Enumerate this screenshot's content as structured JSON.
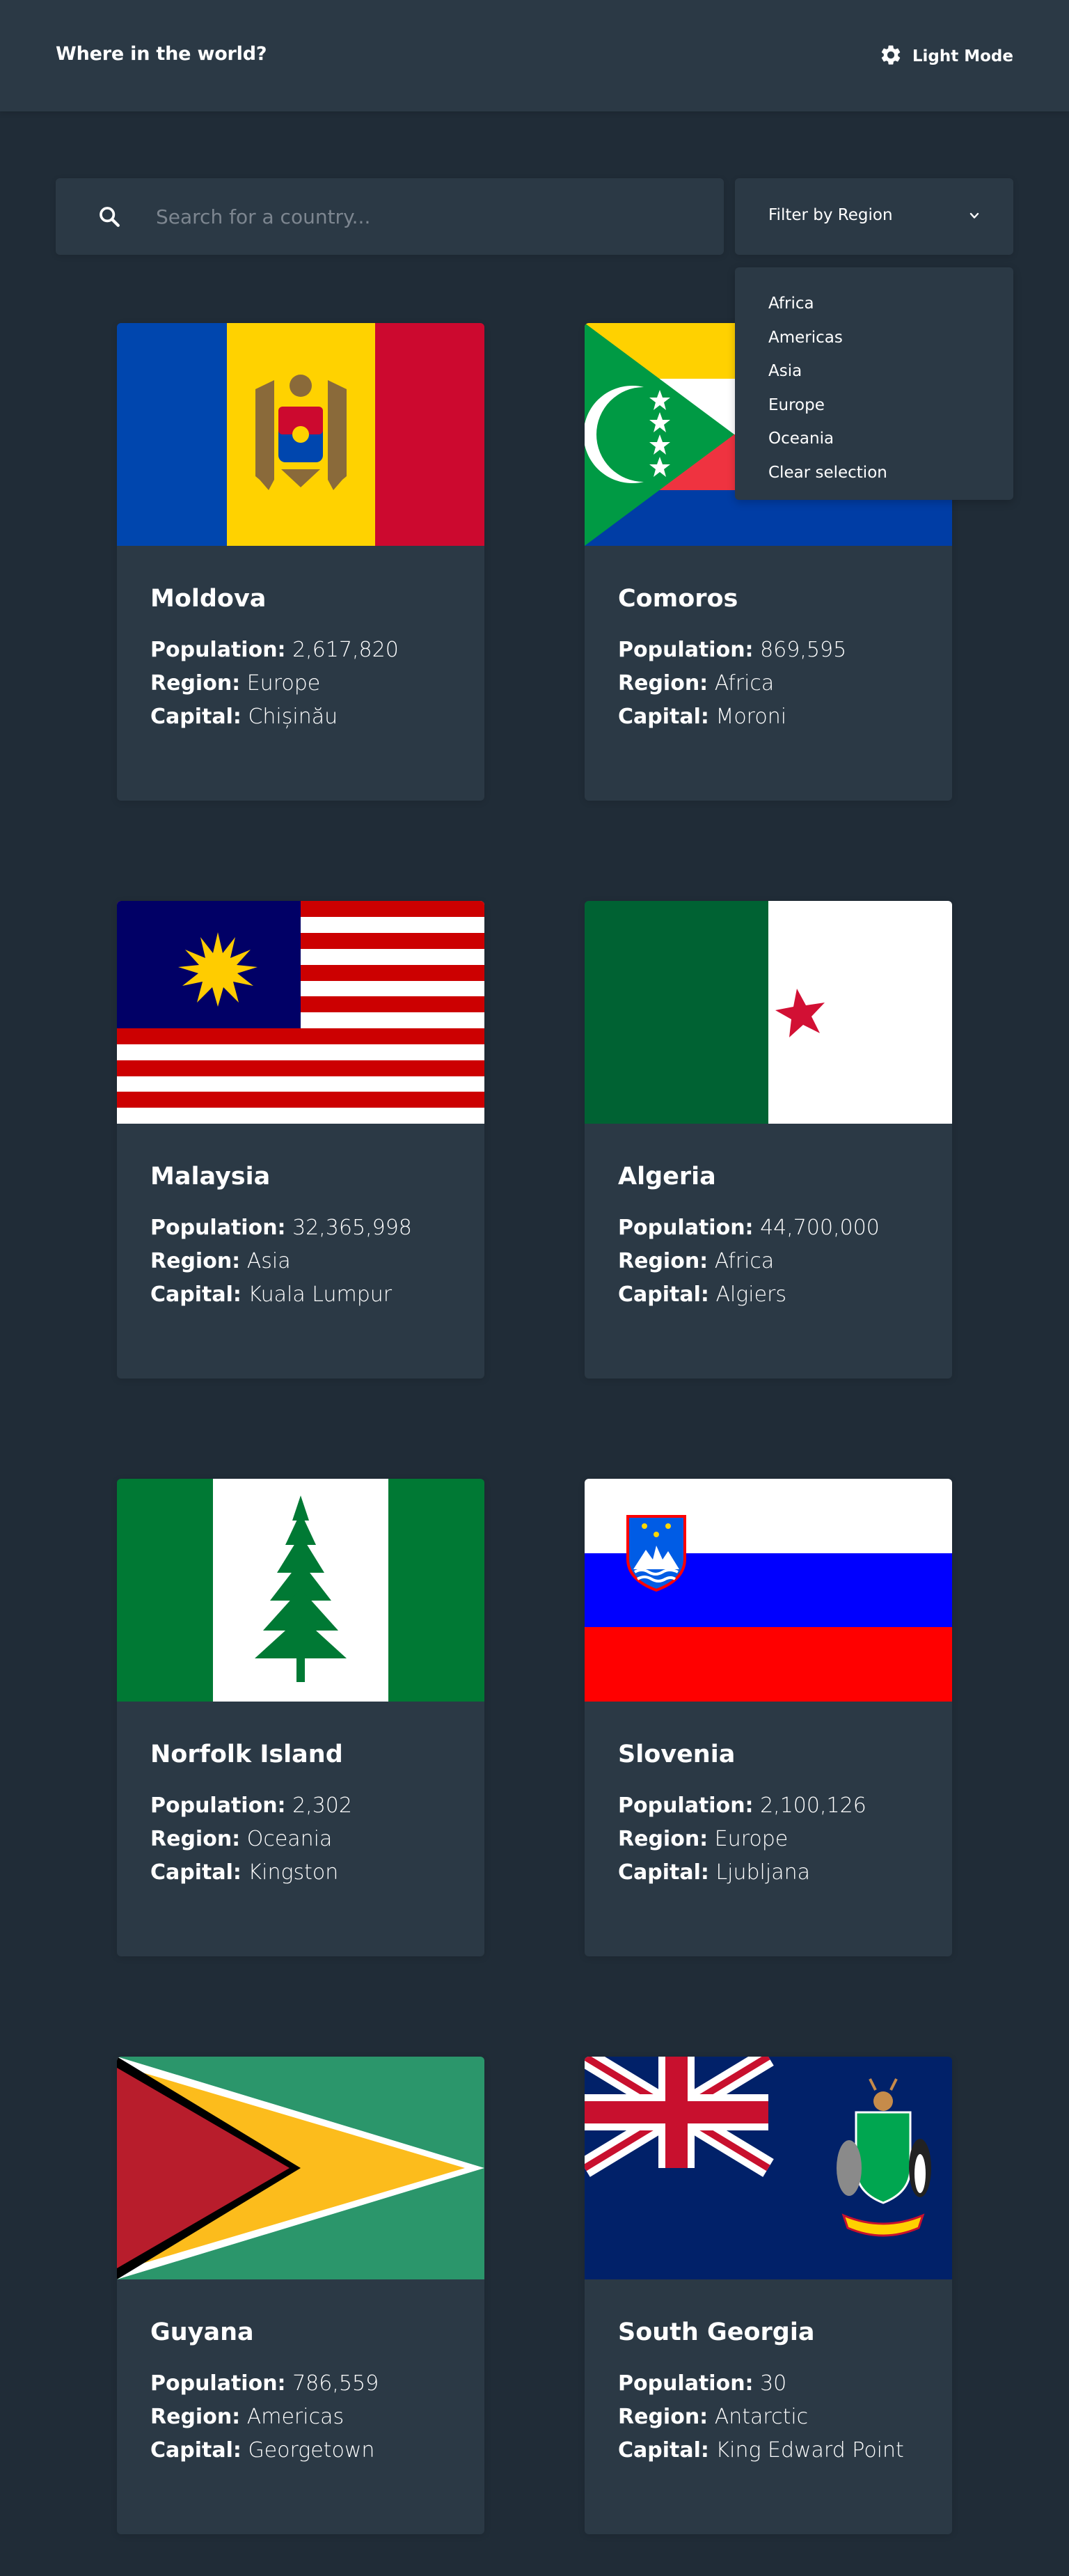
{
  "header": {
    "title": "Where in the world?",
    "theme_toggle_label": "Light Mode",
    "theme_icon": "gear-icon"
  },
  "search": {
    "placeholder": "Search for a country...",
    "value": "",
    "icon": "search-icon"
  },
  "filter": {
    "label": "Filter by Region",
    "icon": "chevron-down-icon",
    "options": [
      "Africa",
      "Americas",
      "Asia",
      "Europe",
      "Oceania",
      "Clear selection"
    ]
  },
  "stat_labels": {
    "population": "Population:",
    "region": "Region:",
    "capital": "Capital:"
  },
  "countries": [
    {
      "name": "Moldova",
      "population": "2,617,820",
      "region": "Europe",
      "capital": "Chișinău"
    },
    {
      "name": "Comoros",
      "population": "869,595",
      "region": "Africa",
      "capital": "Moroni"
    },
    {
      "name": "Malaysia",
      "population": "32,365,998",
      "region": "Asia",
      "capital": "Kuala Lumpur"
    },
    {
      "name": "Algeria",
      "population": "44,700,000",
      "region": "Africa",
      "capital": "Algiers"
    },
    {
      "name": "Norfolk Island",
      "population": "2,302",
      "region": "Oceania",
      "capital": "Kingston"
    },
    {
      "name": "Slovenia",
      "population": "2,100,126",
      "region": "Europe",
      "capital": "Ljubljana"
    },
    {
      "name": "Guyana",
      "population": "786,559",
      "region": "Americas",
      "capital": "Georgetown"
    },
    {
      "name": "South Georgia",
      "population": "30",
      "region": "Antarctic",
      "capital": "King Edward Point"
    }
  ],
  "colors": {
    "background": "#202c37",
    "element": "#2b3945",
    "text": "#ffffff",
    "placeholder": "#7d8690"
  }
}
